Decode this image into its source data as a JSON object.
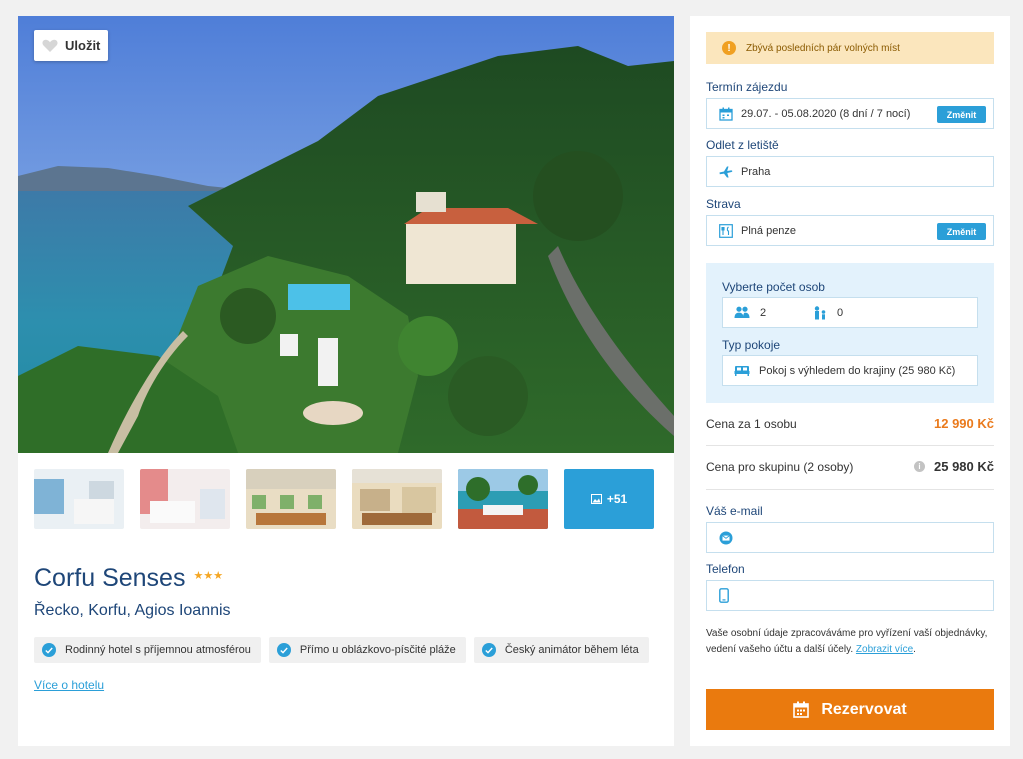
{
  "gallery": {
    "save_label": "Uložit",
    "more_photos": "+51"
  },
  "hotel": {
    "name": "Corfu Senses",
    "stars": "★★★",
    "location": "Řecko, Korfu, Agios Ioannis",
    "features": [
      "Rodinný hotel s příjemnou atmosférou",
      "Přímo u oblázkovo-písčité pláže",
      "Český animátor během léta"
    ],
    "more_link": "Více o hotelu"
  },
  "booking": {
    "alert": "Zbývá posledních pár volných míst",
    "term_label": "Termín zájezdu",
    "term_value": "29.07. - 05.08.2020 (8 dní / 7 nocí)",
    "change_label": "Změnit",
    "departure_label": "Odlet z letiště",
    "departure_value": "Praha",
    "board_label": "Strava",
    "board_value": "Plná penze",
    "persons_label": "Vyberte počet osob",
    "adults": "2",
    "children": "0",
    "room_label": "Typ pokoje",
    "room_value": "Pokoj s výhledem do krajiny (25 980 Kč)",
    "price_person_label": "Cena za 1 osobu",
    "price_person_value": "12 990 Kč",
    "price_group_label": "Cena pro skupinu (2 osoby)",
    "price_group_value": "25 980 Kč",
    "email_label": "Váš e-mail",
    "phone_label": "Telefon",
    "privacy_text": "Vaše osobní údaje zpracováváme pro vyřízení vaší objednávky, vedení vašeho účtu a další účely.",
    "privacy_link": "Zobrazit více",
    "reserve_label": "Rezervovat"
  },
  "colors": {
    "accent_blue": "#2b9fd8",
    "title_blue": "#1e4678",
    "price_orange": "#ea7a1c",
    "cta_orange": "#ea7a0e"
  }
}
